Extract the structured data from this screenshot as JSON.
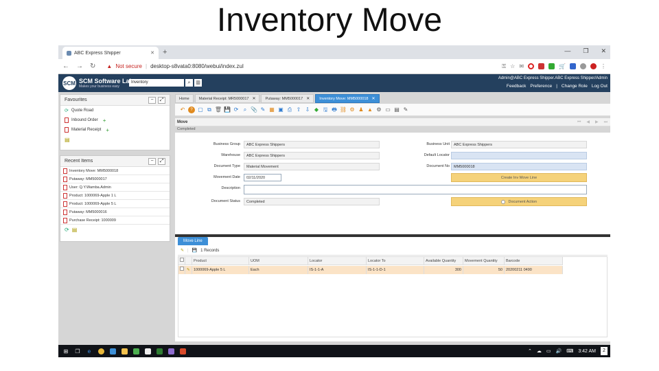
{
  "slide_title": "Inventory Move",
  "browser": {
    "tab_title": "ABC Express Shipper",
    "new_tab": "+",
    "security_label": "Not secure",
    "url": "desktop-s8vata0:8080/webui/index.zul"
  },
  "app": {
    "logo_text": "SCM Software Lab",
    "logo_tagline": "Makes your business easy",
    "logo_mark": "SCM",
    "search_value": "Inventory",
    "user_line": "Admin@ABC Express Shipper.ABC Express Shipper/Admin",
    "header_links": [
      "Feedback",
      "Preference",
      "Change Role",
      "Log Out"
    ]
  },
  "favourites": {
    "title": "Favourites",
    "items": [
      "Quote Road",
      "Inbound Order",
      "Material Receipt"
    ]
  },
  "recent": {
    "title": "Recent Items",
    "items": [
      "Inventory Move: MM5000018",
      "Putaway: MM5000017",
      "User: Q.Y.Wamba.Admin",
      "Product: 1000069-Apple 1 L",
      "Product: 1000069-Apple 5 L",
      "Putaway: MM5000016",
      "Purchase Receipt: 1000009"
    ]
  },
  "content_tabs": [
    {
      "label": "Home",
      "active": false
    },
    {
      "label": "Material Receipt: MR5000017",
      "active": false
    },
    {
      "label": "Putaway: MM5000017",
      "active": false
    },
    {
      "label": "Inventory Move: MM5000018",
      "active": true
    }
  ],
  "window": {
    "title": "Move",
    "status": "Completed"
  },
  "form": {
    "business_group_label": "Business Group",
    "business_group": "ABC Express Shippers",
    "warehouse_label": "Warehouse",
    "warehouse": "ABC Express Shippers",
    "doc_type_label": "Document Type",
    "doc_type": "Material Movement",
    "movement_date_label": "Movement Date",
    "movement_date": "02/11/2020",
    "description_label": "Description",
    "description": "",
    "doc_status_label": "Document Status",
    "doc_status": "Completed",
    "business_unit_label": "Business Unit",
    "business_unit": "ABC Express Shippers",
    "default_locator_label": "Default Locator",
    "default_locator": "",
    "doc_no_label": "Document No",
    "doc_no": "MM5000018",
    "create_line_button": "Create Inv Move Line",
    "doc_action_button": "Document Action"
  },
  "detail": {
    "tab_label": "Move Line",
    "record_count": "1 Records",
    "columns": [
      "Product",
      "UOM",
      "Locator",
      "Locator To",
      "Available Quantity",
      "Movement Quantity",
      "Barcode"
    ],
    "rows": [
      [
        "1000069-Apple 5 L",
        "Each",
        "IS-1-1-A",
        "IS-1-1-D-1",
        "300",
        "50",
        "20200211 0490"
      ]
    ]
  },
  "taskbar": {
    "time": "3:42 AM",
    "notify_count": "2"
  },
  "colors": {
    "app_header": "#24405e",
    "active_tab": "#3d8fd7",
    "action_button": "#f5d27a",
    "selected_row": "#fbe3c6"
  }
}
